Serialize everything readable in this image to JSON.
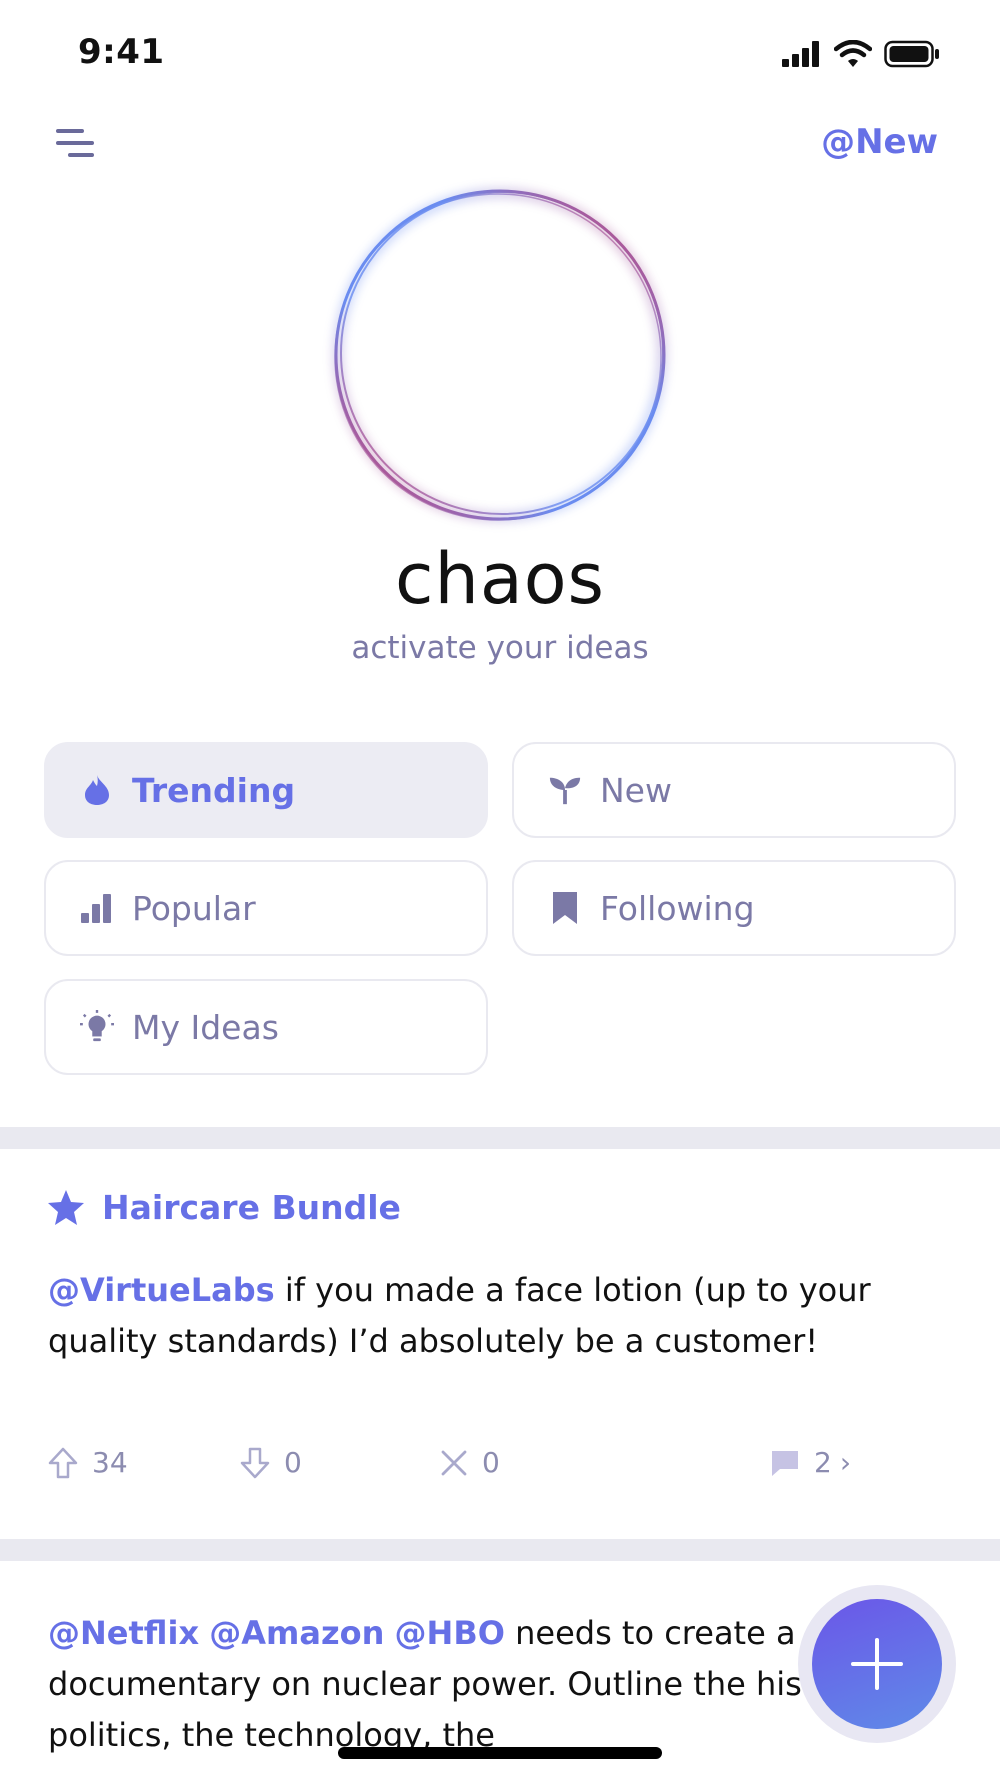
{
  "status_bar": {
    "time": "9:41"
  },
  "header": {
    "new_link": "@New"
  },
  "brand": {
    "name": "chaos",
    "tagline": "activate your ideas"
  },
  "filters": [
    {
      "label": "Trending",
      "icon": "flame-icon",
      "active": true
    },
    {
      "label": "New",
      "icon": "sprout-icon",
      "active": false
    },
    {
      "label": "Popular",
      "icon": "bar-chart-icon",
      "active": false
    },
    {
      "label": "Following",
      "icon": "bookmark-icon",
      "active": false
    },
    {
      "label": "My Ideas",
      "icon": "lightbulb-icon",
      "active": false
    }
  ],
  "posts": [
    {
      "tag": "Haircare Bundle",
      "mention": "@VirtueLabs",
      "text": "if you made a face lotion (up to your quality standards) I’d absolutely be a customer!",
      "upvotes": "34",
      "downvotes": "0",
      "dismissals": "0",
      "comments": "2",
      "comments_chevron": "›"
    },
    {
      "mentions": [
        "@Netflix",
        "@Amazon",
        "@HBO"
      ],
      "text": "needs to create a documentary on nuclear power.  Outline the history, the politics, the technology, the"
    }
  ],
  "colors": {
    "accent": "#6670e6",
    "muted": "#7b79a6",
    "divider": "#e9e9f0",
    "logo_red": "#d6365f",
    "logo_blue": "#6a8cf0"
  }
}
